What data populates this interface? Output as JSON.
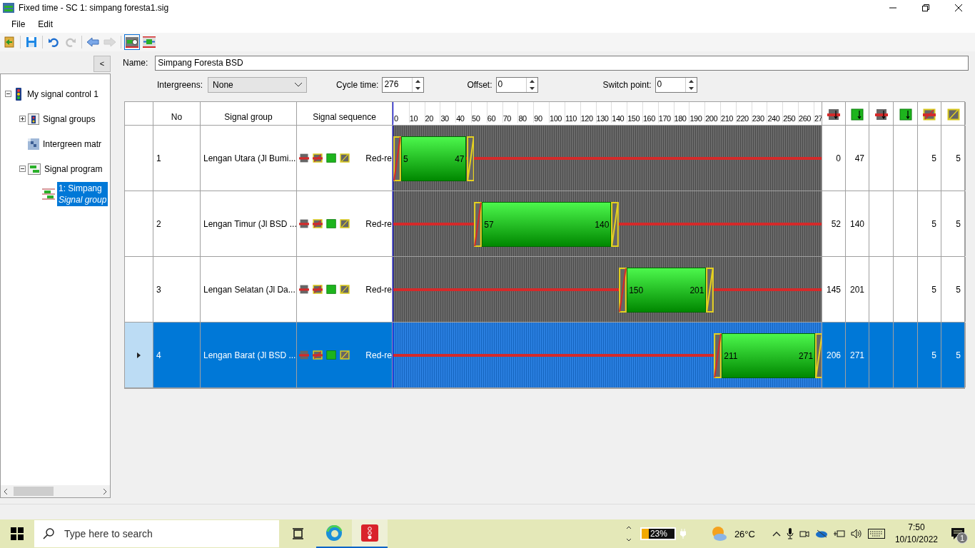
{
  "window": {
    "title": "Fixed time - SC 1: simpang foresta1.sig"
  },
  "menu": [
    {
      "label": "File"
    },
    {
      "label": "Edit"
    }
  ],
  "toolbar": [
    {
      "kind": "open",
      "disabled": false,
      "selected": false
    },
    {
      "kind": "save",
      "disabled": false,
      "selected": false
    },
    {
      "kind": "undo",
      "disabled": false,
      "selected": false
    },
    {
      "kind": "redo",
      "disabled": true,
      "selected": false
    },
    {
      "kind": "back",
      "disabled": false,
      "selected": false
    },
    {
      "kind": "forward",
      "disabled": true,
      "selected": false
    },
    {
      "kind": "view-edit",
      "disabled": false,
      "selected": true
    },
    {
      "kind": "view-fit",
      "disabled": false,
      "selected": false
    }
  ],
  "collapse_button": "<",
  "tree": [
    {
      "label": "My signal control 1",
      "kind": "controller",
      "expanded": true,
      "selected": false,
      "children": [
        {
          "label": "Signal groups",
          "kind": "groups",
          "expanded": false,
          "selected": false
        },
        {
          "label": "Intergreen matr",
          "kind": "matrix",
          "selected": false
        },
        {
          "label": "Signal program",
          "kind": "program",
          "expanded": true,
          "selected": false,
          "children": [
            {
              "label": "1: Simpang",
              "sublabel": "Signal group",
              "kind": "timing",
              "selected": true
            }
          ]
        }
      ]
    }
  ],
  "name": {
    "label": "Name:",
    "value": "Simpang Foresta BSD"
  },
  "intergreens": {
    "label": "Intergreens:",
    "value": "None"
  },
  "cycle_time": {
    "label": "Cycle time:",
    "value": "276"
  },
  "offset": {
    "label": "Offset:",
    "value": "0"
  },
  "switch_point": {
    "label": "Switch point:",
    "value": "0"
  },
  "table": {
    "columns": [
      "No",
      "Signal group",
      "Signal sequence"
    ],
    "ticks": [
      "0",
      "10",
      "20",
      "30",
      "40",
      "50",
      "60",
      "70",
      "80",
      "90",
      "100",
      "110",
      "120",
      "130",
      "140",
      "150",
      "160",
      "170",
      "180",
      "190",
      "200",
      "210",
      "220",
      "230",
      "240",
      "250",
      "260",
      "27"
    ],
    "rows": [
      {
        "no": "1",
        "group": "Lengan Utara (Jl Bumi...",
        "sequence": "Red-re",
        "bar_start": "5",
        "bar_end": "47",
        "column_1": "0",
        "column_2": "47",
        "column_5": "5",
        "column_6": "5",
        "selected": false
      },
      {
        "no": "2",
        "group": "Lengan Timur (Jl BSD ...",
        "sequence": "Red-re",
        "bar_start": "57",
        "bar_end": "140",
        "column_1": "52",
        "column_2": "140",
        "column_5": "5",
        "column_6": "5",
        "selected": false
      },
      {
        "no": "3",
        "group": "Lengan Selatan (Jl Da...",
        "sequence": "Red-re",
        "bar_start": "150",
        "bar_end": "201",
        "column_1": "145",
        "column_2": "201",
        "column_5": "5",
        "column_6": "5",
        "selected": false
      },
      {
        "no": "4",
        "group": "Lengan Barat (Jl BSD ...",
        "sequence": "Red-re",
        "bar_start": "211",
        "bar_end": "271",
        "column_1": "206",
        "column_2": "271",
        "column_5": "5",
        "column_6": "5",
        "selected": true
      }
    ]
  },
  "taskbar": {
    "search_placeholder": "Type here to search",
    "battery": "23%",
    "temperature": "26°C",
    "time": "7:50",
    "date": "10/10/2022",
    "notifications": "1"
  }
}
